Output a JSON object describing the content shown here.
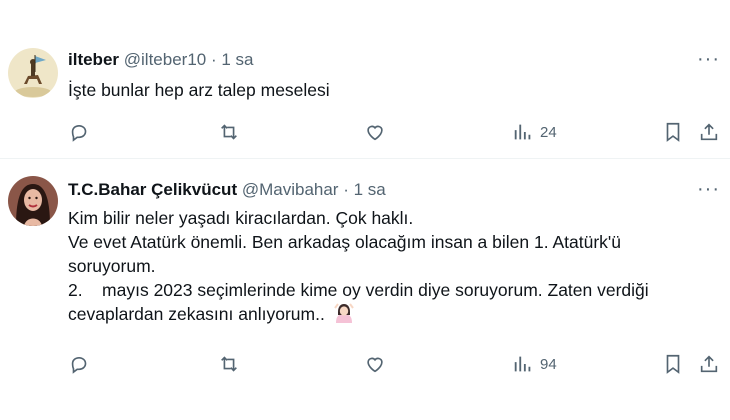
{
  "tweets": [
    {
      "name": "ilteber",
      "handle": "@ilteber10",
      "separator": "·",
      "time": "1 sa",
      "more": "···",
      "lines": [
        "İşte bunlar hep arz talep meselesi"
      ],
      "views": "24"
    },
    {
      "name": "T.C.Bahar Çelikvücut",
      "handle": "@Mavibahar",
      "separator": "·",
      "time": "1 sa",
      "more": "···",
      "lines": [
        "Kim bilir neler yaşadı kiracılardan. Çok haklı.",
        "Ve evet Atatürk önemli. Ben arkadaş olacağım insan a bilen 1. Atatürk'ü",
        "soruyorum.",
        "2.    mayıs 2023 seçimlerinde kime oy verdin diye soruyorum. Zaten verdiği",
        "cevaplardan zekasını anlıyorum.."
      ],
      "emoji": "person-gesturing-ok-emoji",
      "views": "94"
    }
  ],
  "icons": [
    "reply-icon",
    "retweet-icon",
    "like-icon",
    "views-icon",
    "bookmark-icon",
    "share-icon"
  ],
  "colors": {
    "text": "#0f1419",
    "secondary": "#536471",
    "divider": "#eff3f4"
  }
}
